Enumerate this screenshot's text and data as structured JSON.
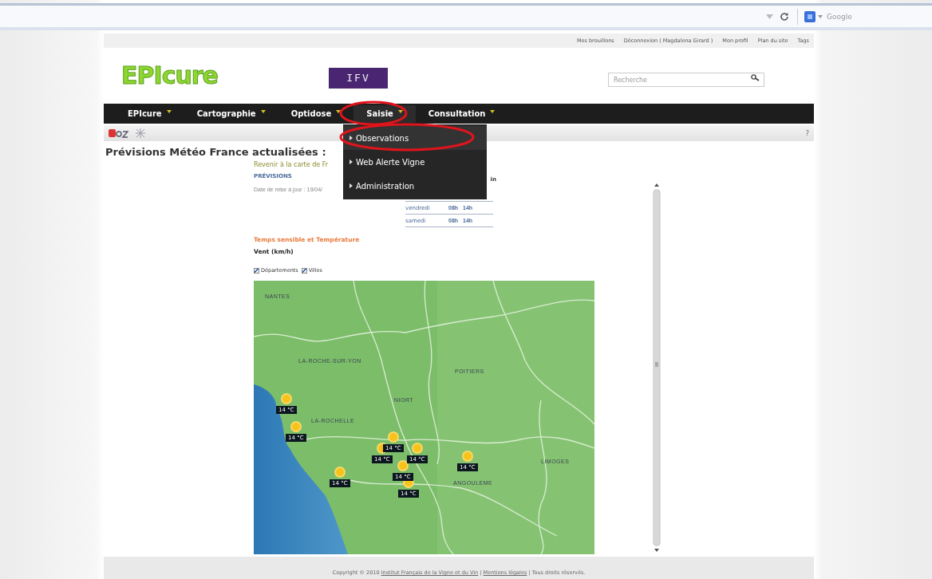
{
  "browser": {
    "search_placeholder": "Google"
  },
  "top_links": [
    "Mes brouillons",
    "Déconnexion ( Magdalena Girard )",
    "Mon profil",
    "Plan du site",
    "Tags"
  ],
  "header": {
    "logo": "EPIcure",
    "partner_logo": "IFV",
    "search_placeholder": "Recherche"
  },
  "nav": [
    {
      "label": "EPIcure",
      "selected": false
    },
    {
      "label": "Cartographie",
      "selected": false
    },
    {
      "label": "Optidose",
      "selected": false
    },
    {
      "label": "Saisie",
      "selected": true
    },
    {
      "label": "Consultation",
      "selected": false
    }
  ],
  "dropdown": {
    "items": [
      {
        "label": "Observations",
        "selected": true
      },
      {
        "label": "Web Alerte Vigne",
        "selected": false
      },
      {
        "label": "Administration",
        "selected": false
      }
    ]
  },
  "toolbar": {
    "help": "?"
  },
  "page_title": "Prévisions Météo France actualisées :",
  "forecast": {
    "back_link": "Revenir à la carte de Fr",
    "heading": "PRÉVISIONS",
    "updated": "Date de mise à jour : 19/04/",
    "table_header_tail": "in",
    "rows": [
      {
        "day": "vendredi",
        "morning": "08h",
        "afternoon": "14h"
      },
      {
        "day": "samedi",
        "morning": "08h",
        "afternoon": "14h"
      }
    ],
    "section": "Temps sensible et Température",
    "wind": "Vent (km/h)",
    "toggles": [
      {
        "label": "Départements",
        "checked": true
      },
      {
        "label": "Villes",
        "checked": true
      }
    ]
  },
  "map": {
    "cities": [
      "NANTES",
      "LA-ROCHE-SUR-YON",
      "POITIERS",
      "NIORT",
      "LA-ROCHELLE",
      "ANGOULEME",
      "LIMOGES"
    ],
    "markers": [
      {
        "temp": "14 °C"
      },
      {
        "temp": "14 °C"
      },
      {
        "temp": "14 °C"
      },
      {
        "temp": "14 °C"
      },
      {
        "temp": "14 °C"
      },
      {
        "temp": "14 °C"
      },
      {
        "temp": "14 °C"
      },
      {
        "temp": "14 °C"
      },
      {
        "temp": "14 °C"
      }
    ]
  },
  "footer": [
    {
      "kind": "text",
      "text": "Copyright © 2010"
    },
    {
      "kind": "link",
      "text": "Institut Français de la Vigne et du Vin"
    },
    {
      "kind": "text",
      "text": "|"
    },
    {
      "kind": "link",
      "text": "Mentions légales"
    },
    {
      "kind": "text",
      "text": "| Tous droits réservés."
    }
  ]
}
